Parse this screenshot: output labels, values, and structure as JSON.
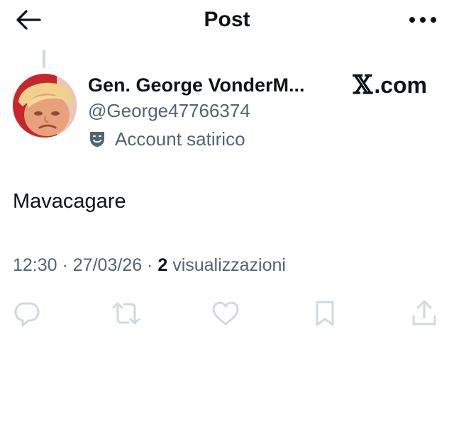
{
  "header": {
    "title": "Post",
    "back_icon": "arrow-left-icon",
    "more_icon": "more-horizontal-icon"
  },
  "author": {
    "display_name": "Gen. George VonderM...",
    "handle": "@George47766374",
    "label_icon": "theater-masks-icon",
    "label": "Account satirico"
  },
  "brand": {
    "logo_mark": "𝕏",
    "logo_text": ".com"
  },
  "post": {
    "text": "Mavacagare",
    "time": "12:30",
    "separator": " · ",
    "date": "27/03/26",
    "views_count": "2",
    "views_label": "visualizzazioni"
  },
  "actions": [
    {
      "name": "reply",
      "icon": "reply-icon"
    },
    {
      "name": "repost",
      "icon": "repost-icon"
    },
    {
      "name": "like",
      "icon": "heart-icon"
    },
    {
      "name": "bookmark",
      "icon": "bookmark-icon"
    },
    {
      "name": "share",
      "icon": "share-icon"
    }
  ],
  "colors": {
    "text_primary": "#0f1419",
    "text_secondary": "#536471",
    "icon_muted": "#cfd9de"
  }
}
